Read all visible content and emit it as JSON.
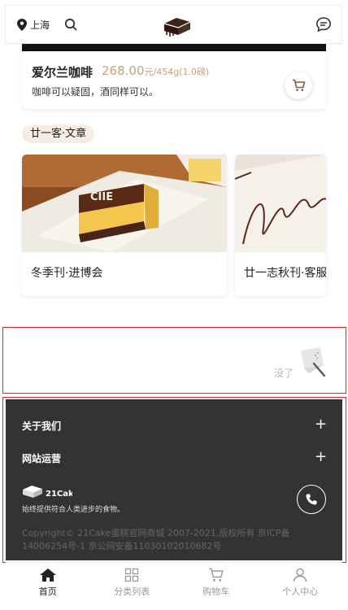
{
  "header": {
    "location": "上海",
    "location_icon": "map-pin-icon",
    "search_icon": "search-icon",
    "logo": "cake-logo",
    "message_icon": "chat-bubble-icon"
  },
  "product": {
    "name": "爱尔兰咖啡",
    "price": "268.00",
    "unit": "元/454g(1.0磅)",
    "desc": "咖啡可以疑固，酒同样可以。",
    "cart_icon": "cart-icon"
  },
  "section": {
    "tag": "廿一客·文章"
  },
  "articles": [
    {
      "title": "冬季刊·进博会"
    },
    {
      "title": "廿一志秋刊·客服"
    }
  ],
  "end": {
    "text": "没了"
  },
  "footer": {
    "about": "关于我们",
    "operation": "网站运营",
    "plus": "+",
    "brand_text": "21Cake",
    "slogan": "始终提供符合人类进步的食物。",
    "copyright": "Copyright© 21Cake蛋糕官网商城 2007-2021,版权所有  京ICP备14006254号-1    京公网安备11030102010682号"
  },
  "nav": {
    "items": [
      {
        "label": "首页",
        "icon": "home-icon",
        "active": true
      },
      {
        "label": "分类列表",
        "icon": "grid-icon",
        "active": false
      },
      {
        "label": "购物车",
        "icon": "cart-icon",
        "active": false
      },
      {
        "label": "个人中心",
        "icon": "user-icon",
        "active": false
      }
    ]
  },
  "colors": {
    "accent": "#c8a27a",
    "footer_bg": "#333333",
    "highlight_border": "#e0242a",
    "tag_bg": "#f5ece2"
  }
}
